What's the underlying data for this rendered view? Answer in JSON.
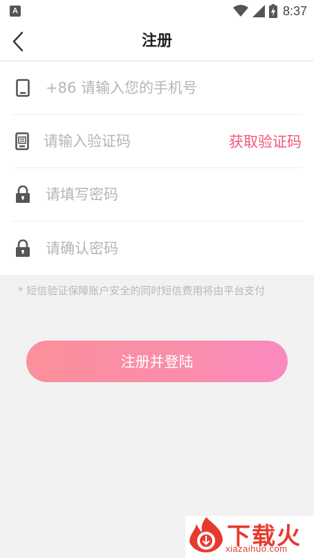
{
  "status_bar": {
    "app_icon_letter": "A",
    "time": "8:37",
    "icons": [
      "wifi-icon",
      "signal-icon",
      "battery-charging-icon"
    ]
  },
  "header": {
    "title": "注册",
    "back_icon": "chevron-left-icon"
  },
  "form": {
    "phone": {
      "placeholder": "+86 请输入您的手机号",
      "value": "",
      "icon": "phone-icon"
    },
    "code": {
      "placeholder": "请输入验证码",
      "value": "",
      "icon": "sms-code-icon",
      "get_code_label": "获取验证码"
    },
    "password": {
      "placeholder": "请填写密码",
      "value": "",
      "icon": "lock-icon"
    },
    "confirm_password": {
      "placeholder": "请确认密码",
      "value": "",
      "icon": "lock-icon"
    }
  },
  "notice": "* 短信验证保障账户安全的同时短信费用将由平台支付",
  "submit_label": "注册并登陆",
  "watermark": {
    "text": "下载火",
    "domain": "xiazaihuo.com"
  },
  "colors": {
    "accent": "#f2577a",
    "button_gradient_start": "#fb8f9a",
    "button_gradient_end": "#fb89c0",
    "placeholder": "#b5b5b5",
    "background": "#f2f2f2"
  }
}
